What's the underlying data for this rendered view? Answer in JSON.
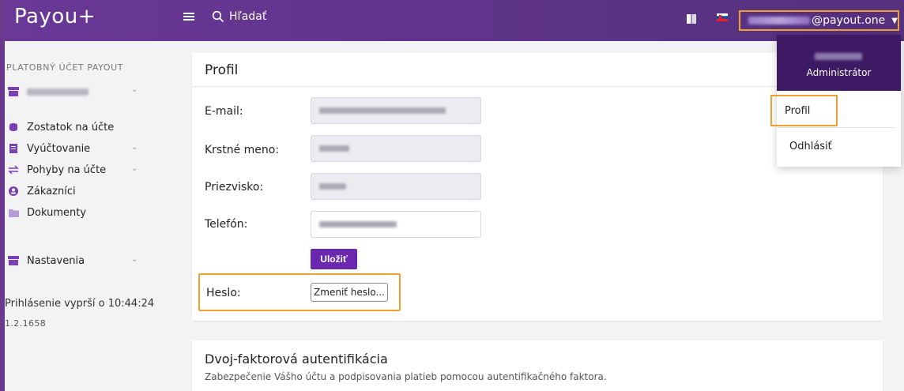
{
  "header": {
    "logo": "Payou+",
    "search_label": "Hľadať",
    "user_email_suffix": "@payout.one"
  },
  "sidebar": {
    "heading": "PLATOBNÝ ÚČET PAYOUT",
    "items": [
      {
        "label": "Zostatok na účte",
        "icon": "coins-icon"
      },
      {
        "label": "Vyúčtovanie",
        "icon": "invoice-icon"
      },
      {
        "label": "Pohyby na účte",
        "icon": "transfer-icon"
      },
      {
        "label": "Zákazníci",
        "icon": "customers-icon"
      },
      {
        "label": "Dokumenty",
        "icon": "folder-icon"
      },
      {
        "label": "Nastavenia",
        "icon": "settings-icon"
      }
    ],
    "session_text": "Prihlásenie vyprší o 10:44:24",
    "version": "1.2.1658"
  },
  "profile": {
    "title": "Profil",
    "fields": [
      {
        "label": "E-mail:"
      },
      {
        "label": "Krstné meno:"
      },
      {
        "label": "Priezvisko:"
      },
      {
        "label": "Telefón:"
      }
    ],
    "save_label": "Uložiť",
    "password_label": "Heslo:",
    "change_password_label": "Zmeniť heslo..."
  },
  "two_factor": {
    "title": "Dvoj-faktorová autentifikácia",
    "subtitle": "Zabezpečenie Vášho účtu a podpisovania platieb pomocou autentifikačného faktora."
  },
  "dropdown": {
    "role": "Administrátor",
    "profile_label": "Profil",
    "logout_label": "Odhlásiť"
  },
  "colors": {
    "topbar": "#6a3897",
    "accent": "#6a28b0",
    "highlight": "#f0a030",
    "dropdown_header": "#3e1a64"
  }
}
